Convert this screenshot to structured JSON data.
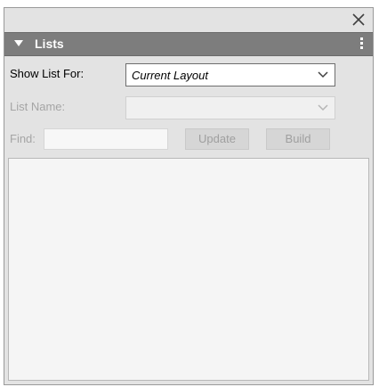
{
  "panel": {
    "header_title": "Lists"
  },
  "form": {
    "show_list_for_label": "Show List For:",
    "show_list_for_value": "Current Layout",
    "list_name_label": "List Name:",
    "list_name_value": "",
    "find_label": "Find:",
    "find_value": "",
    "update_label": "Update",
    "build_label": "Build"
  },
  "icons": {
    "close": "close-icon",
    "header_collapse": "triangle-down-icon",
    "header_menu": "vertical-ellipsis-icon",
    "dropdown": "chevron-down-icon"
  },
  "colors": {
    "header_bg": "#7d7d7d",
    "panel_bg": "#e3e3e3",
    "list_bg": "#f5f5f5"
  }
}
